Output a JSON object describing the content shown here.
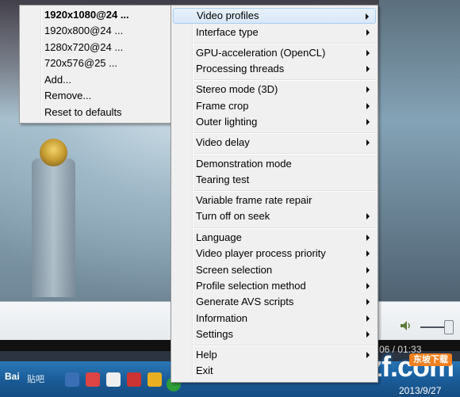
{
  "video_profiles_submenu": [
    {
      "label": "1920x1080@24 ...",
      "bold": true
    },
    {
      "label": "1920x800@24 ..."
    },
    {
      "label": "1280x720@24 ..."
    },
    {
      "label": "720x576@25 ..."
    },
    {
      "label": "Add..."
    },
    {
      "label": "Remove..."
    },
    {
      "label": "Reset to defaults"
    }
  ],
  "context_menu": {
    "video_profiles": "Video profiles",
    "interface_type": "Interface type",
    "gpu_acceleration": "GPU-acceleration (OpenCL)",
    "processing_threads": "Processing threads",
    "stereo_mode": "Stereo mode (3D)",
    "frame_crop": "Frame crop",
    "outer_lighting": "Outer lighting",
    "video_delay": "Video delay",
    "demonstration_mode": "Demonstration mode",
    "tearing_test": "Tearing test",
    "variable_frame_rate_repair": "Variable frame rate repair",
    "turn_off_on_seek": "Turn off on seek",
    "language": "Language",
    "process_priority": "Video player process priority",
    "screen_selection": "Screen selection",
    "profile_selection_method": "Profile selection method",
    "generate_avs_scripts": "Generate AVS scripts",
    "information": "Information",
    "settings": "Settings",
    "help": "Help",
    "exit": "Exit"
  },
  "player": {
    "time": "06 / 01:33"
  },
  "taskbar": {
    "baidu_label": "Bai",
    "tieba_label": "贴吧",
    "date": "2013/9/27"
  },
  "watermark": {
    "text": "uzzf.com",
    "badge": "东坡下载"
  },
  "colors": {
    "menu_bg": "#f0f0f0",
    "highlight": "#d9e8f8",
    "taskbar": "#1b5d99"
  }
}
